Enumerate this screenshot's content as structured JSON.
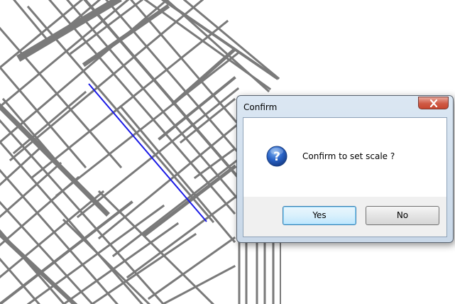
{
  "dialog": {
    "title": "Confirm",
    "message": "Confirm to set scale ?",
    "yes_label": "Yes",
    "no_label": "No",
    "icon": "question-icon",
    "close_icon": "close-icon"
  },
  "drawing": {
    "line_color": "#7a7a7a",
    "measure_line_color": "#1a1ae6"
  },
  "colors": {
    "dialog_frame": "#c9d8e8",
    "close_button": "#c7472f",
    "default_button_border": "#3c7fb1"
  }
}
